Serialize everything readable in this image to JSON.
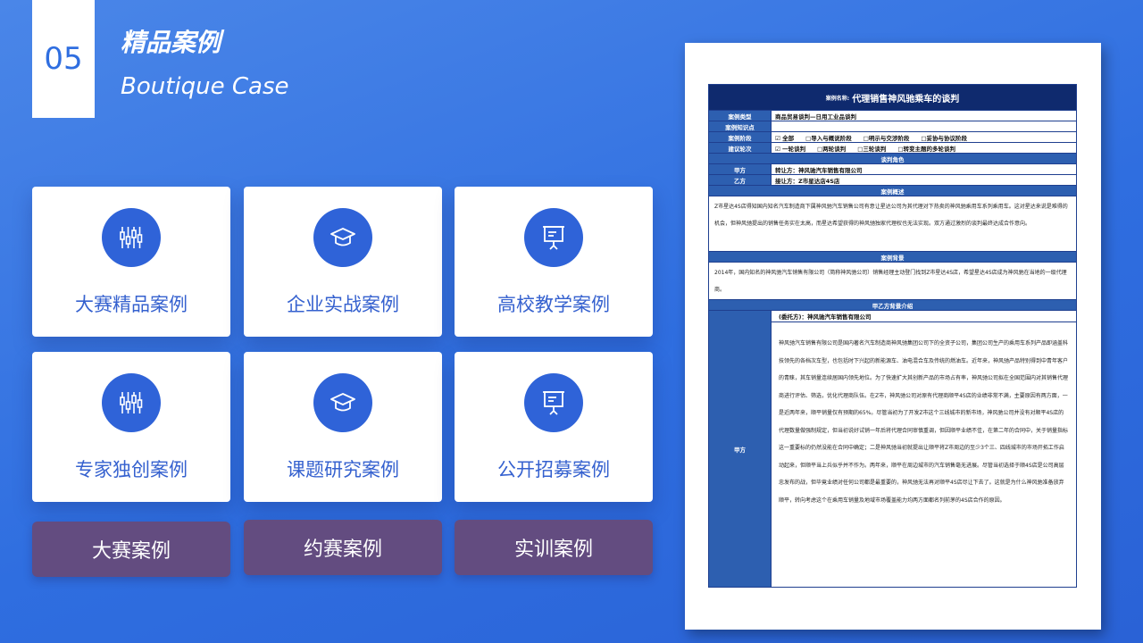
{
  "header": {
    "number": "05",
    "title_cn": "精品案例",
    "title_en": "Boutique Case"
  },
  "cards": [
    {
      "label": "大赛精品案例",
      "icon": "sliders-icon"
    },
    {
      "label": "企业实战案例",
      "icon": "graduation-cap-icon"
    },
    {
      "label": "高校教学案例",
      "icon": "presentation-board-icon"
    },
    {
      "label": "专家独创案例",
      "icon": "sliders-icon"
    },
    {
      "label": "课题研究案例",
      "icon": "graduation-cap-icon"
    },
    {
      "label": "公开招募案例",
      "icon": "presentation-board-icon"
    }
  ],
  "buttons": [
    {
      "label": "大赛案例"
    },
    {
      "label": "约赛案例"
    },
    {
      "label": "实训案例"
    }
  ],
  "document": {
    "title_prefix": "案例名称:",
    "title": "代理销售神风驰乘车的谈判",
    "rows": [
      {
        "key": "案例类型",
        "val": "商品贸易谈判—日用工业品谈判"
      },
      {
        "key": "案例知识点",
        "val": ""
      },
      {
        "key": "案例阶段",
        "val": "☑ 全部　　□导入与概说阶段　　□明示与交涉阶段　　□妥协与协议阶段"
      },
      {
        "key": "建议轮次",
        "val": "☑ 一轮谈判　　□两轮谈判　　□三轮谈判　　□转变主题的多轮谈判"
      }
    ],
    "role_section": "谈判角色",
    "party_rows": [
      {
        "key": "甲方",
        "val": "转让方：神风驰汽车销售有限公司"
      },
      {
        "key": "乙方",
        "val": "接让方：Z市星达店4S店"
      }
    ],
    "overview_section": "案例概述",
    "overview_text": "Z市星达4S店得知国内知名汽车制造商下属神风驰汽车销售公司有意让星达公司为其代理对下热卖的神风驰乘用车系列乘用车。这对星达来说是难得的机会，但神风驰提出的销售任务实在太高，而星达希望获得的神风驰独家代理权也无法实现。双方通过激烈的谈判最终达成合作意向。",
    "background_section": "案例背景",
    "background_text": "2014年，国内知名的神风驰汽车销售有限公司（简称神风驰公司）销售经理主动登门找到Z市星达4S店，希望星达4S店成为神风驰在当地的一级代理商。",
    "intro_section": "甲乙方背景介绍",
    "party_a_key": "甲方",
    "party_a_head": "(委托方)：神风驰汽车销售有限公司",
    "party_a_text": "神风驰汽车销售有限公司是国内著名汽车制造商神风驰集团公司下的全资子公司，集团公司生产的乘用车系列产品即涵盖科技领先的各档次车型，也包括时下兴起的新能源车、油电混合车及传统的燃油车。近年来，神风驰产品特别得到中青年客户的青睐，其车销量连续居国内领先地位。为了快速扩大其创新产品的市场占有率，神风驰公司拟在全国范围内对其销售代理商进行评估、筛选，优化代理商队伍。在Z市，神风驰公司对原有代理商顺平4S店的业绩非常不满，主要原因有两方面，一是近两年来，顺平销量仅有预期的65%。尽管当初为了开发Z市这个三线城市的新市场，神风驰公司并没有对顺平4S店的代理数量做强制规定，但当初说好试销一年后将代理合同审慎重调，但因顺平业绩不佳，在第二年的合同中，关于销量指标这一重要标的仍然没能在合同中确定；二是神风驰当初就提出让顺平将Z市周边的至少3个三、四线城市的市场开拓工作启动起来，但顺平当上兵似乎并不作为。两年来，顺平在周边城市的汽车销售毫无进展。尽管当初选择于顺4S店是公司高层忠发布的战，但毕竟业绩对任何公司都是最重要的，神风驰无法再对顺平4S店尽让下去了。这就是为什么神风驰准备放弃顺平，转向考虑这个在乘用车销量及地域市场覆盖能力均两方面都名列前茅的4S店合作的原因。"
  }
}
